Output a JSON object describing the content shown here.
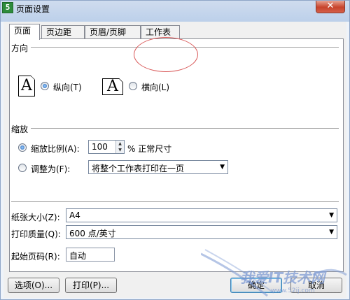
{
  "window": {
    "title": "页面设置",
    "app_icon_glyph": "5",
    "close_glyph": "✕"
  },
  "tabs": [
    {
      "label": "页面",
      "active": true
    },
    {
      "label": "页边距",
      "active": false
    },
    {
      "label": "页眉/页脚",
      "active": false
    },
    {
      "label": "工作表",
      "active": false
    }
  ],
  "orientation": {
    "section_label": "方向",
    "portrait_glyph": "A",
    "portrait_label": "纵向(T)",
    "portrait_selected": true,
    "landscape_glyph": "A",
    "landscape_label": "横向(L)",
    "landscape_selected": false
  },
  "scaling": {
    "section_label": "缩放",
    "adjust_label": "缩放比例(A):",
    "adjust_value": "100",
    "adjust_suffix": "% 正常尺寸",
    "adjust_selected": true,
    "fit_label": "调整为(F):",
    "fit_value": "将整个工作表打印在一页",
    "fit_selected": false
  },
  "paper": {
    "size_label": "纸张大小(Z):",
    "size_value": "A4",
    "quality_label": "打印质量(Q):",
    "quality_value": "600 点/英寸",
    "first_page_label": "起始页码(R):",
    "first_page_value": "自动"
  },
  "buttons": {
    "options": "选项(O)...",
    "print": "打印(P)...",
    "ok": "确定",
    "cancel": "取消"
  },
  "watermark": {
    "text": "我爱IT技术网",
    "url": "www.52ij.com"
  },
  "colors": {
    "annotation": "#d95a5a",
    "title_bar": "#bcd0ea",
    "close_button": "#c7432b"
  },
  "icons": [
    "app-icon",
    "close-icon",
    "portrait-page-icon",
    "landscape-page-icon",
    "spin-up-icon",
    "spin-down-icon",
    "chevron-down-icon"
  ]
}
